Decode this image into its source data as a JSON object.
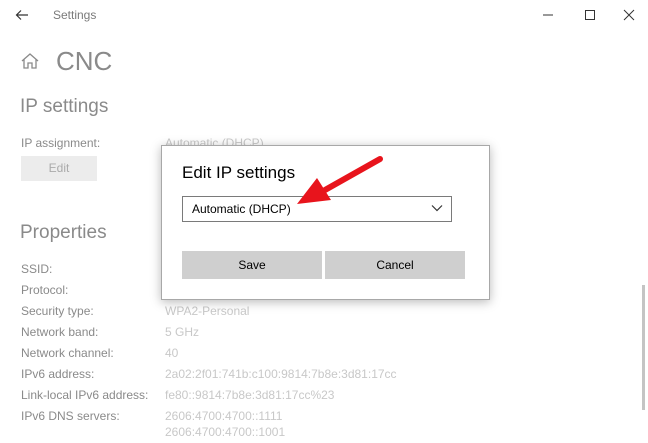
{
  "window": {
    "title": "Settings"
  },
  "page": {
    "title": "CNC"
  },
  "ip_settings": {
    "heading": "IP settings",
    "assignment_label": "IP assignment:",
    "assignment_value": "Automatic (DHCP)",
    "edit_label": "Edit"
  },
  "properties": {
    "heading": "Properties",
    "rows": [
      {
        "label": "SSID:",
        "value": ""
      },
      {
        "label": "Protocol:",
        "value": ""
      },
      {
        "label": "Security type:",
        "value": "WPA2-Personal"
      },
      {
        "label": "Network band:",
        "value": "5 GHz"
      },
      {
        "label": "Network channel:",
        "value": "40"
      },
      {
        "label": "IPv6 address:",
        "value": "2a02:2f01:741b:c100:9814:7b8e:3d81:17cc"
      },
      {
        "label": "Link-local IPv6 address:",
        "value": "fe80::9814:7b8e:3d81:17cc%23"
      },
      {
        "label": "IPv6 DNS servers:",
        "value": "2606:4700:4700::1111"
      }
    ],
    "dns_secondary": "2606:4700:4700::1001"
  },
  "dialog": {
    "title": "Edit IP settings",
    "selected_option": "Automatic (DHCP)",
    "save_label": "Save",
    "cancel_label": "Cancel"
  },
  "colors": {
    "annotation_arrow": "#e8141c",
    "button": "#cfcfcf"
  }
}
